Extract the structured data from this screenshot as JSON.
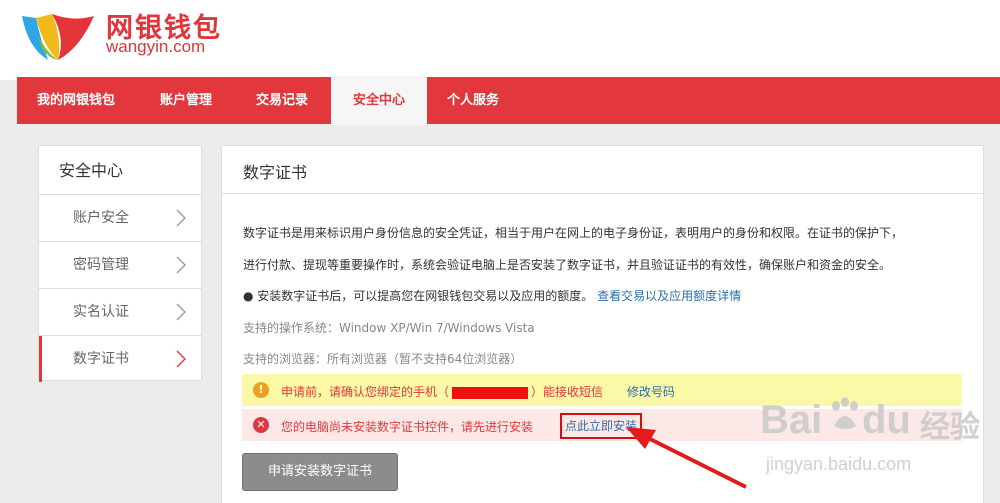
{
  "brand": {
    "name_cn": "网银钱包",
    "name_en": "wangyin.com"
  },
  "nav": {
    "items": [
      {
        "label": "我的网银钱包",
        "active": false
      },
      {
        "label": "账户管理",
        "active": false
      },
      {
        "label": "交易记录",
        "active": false
      },
      {
        "label": "安全中心",
        "active": true
      },
      {
        "label": "个人服务",
        "active": false
      }
    ]
  },
  "sidebar": {
    "title": "安全中心",
    "items": [
      {
        "label": "账户安全",
        "active": false
      },
      {
        "label": "密码管理",
        "active": false
      },
      {
        "label": "实名认证",
        "active": false
      },
      {
        "label": "数字证书",
        "active": true
      }
    ]
  },
  "main": {
    "title": "数字证书",
    "desc_line1": "数字证书是用来标识用户身份信息的安全凭证，相当于用户在网上的电子身份证，表明用户的身份和权限。在证书的保护下，",
    "desc_line2": "进行付款、提现等重要操作时，系统会验证电脑上是否安装了数字证书，并且验证证书的有效性，确保账户和资金的安全。",
    "bullet_text": "● 安装数字证书后，可以提高您在网银钱包交易以及应用的额度。",
    "bullet_link": "查看交易以及应用额度详情",
    "os_support": "支持的操作系统：Window XP/Win 7/Windows Vista",
    "browser_support": "支持的浏览器：所有浏览器（暂不支持64位浏览器）",
    "warning": {
      "icon": "exclamation-icon",
      "text_before": "申请前，请确认您绑定的手机（",
      "text_after": "）能接收短信",
      "link": "修改号码",
      "color": "#f0a020"
    },
    "error": {
      "icon": "error-x-icon",
      "text": "您的电脑尚未安装数字证书控件，请先进行安装",
      "link": "点此立即安装",
      "color": "#d9393e"
    },
    "apply_button": "申请安装数字证书"
  },
  "watermark": {
    "brand": "Bai",
    "brand_suffix": "du",
    "cn": "经验",
    "url": "jingyan.baidu.com"
  },
  "colors": {
    "brand_red": "#e2373c",
    "link_blue": "#2a6fb0",
    "warning_bg": "#fbf8a8",
    "error_bg": "#fde8e8"
  }
}
